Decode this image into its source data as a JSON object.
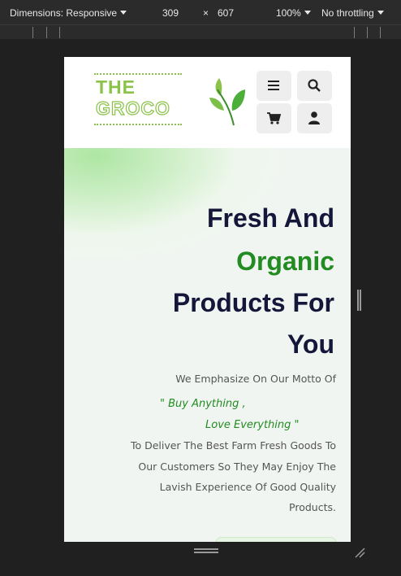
{
  "devtools": {
    "dimensions_label": "Dimensions: Responsive",
    "width": "309",
    "times": "×",
    "height": "607",
    "zoom": "100%",
    "throttling": "No throttling"
  },
  "header": {
    "logo_top": "THE",
    "logo_bottom": "GROCO"
  },
  "hero": {
    "title_line1": "Fresh And",
    "title_line2": "Organic",
    "title_line3": "Products For",
    "title_line4": "You",
    "motto_intro": "We Emphasize On Our Motto Of",
    "motto_line1": "\" Buy Anything ,",
    "motto_line2": "Love Everything \"",
    "desc_line1": "To Deliver The Best Farm Fresh Goods To",
    "desc_line2": "Our Customers So They May Enjoy The",
    "desc_line3": "Lavish Experience Of Good Quality",
    "desc_line4": "Products."
  },
  "colors": {
    "brand_green": "#228b22",
    "logo_green": "#8bc34a",
    "title_navy": "#14163a"
  }
}
